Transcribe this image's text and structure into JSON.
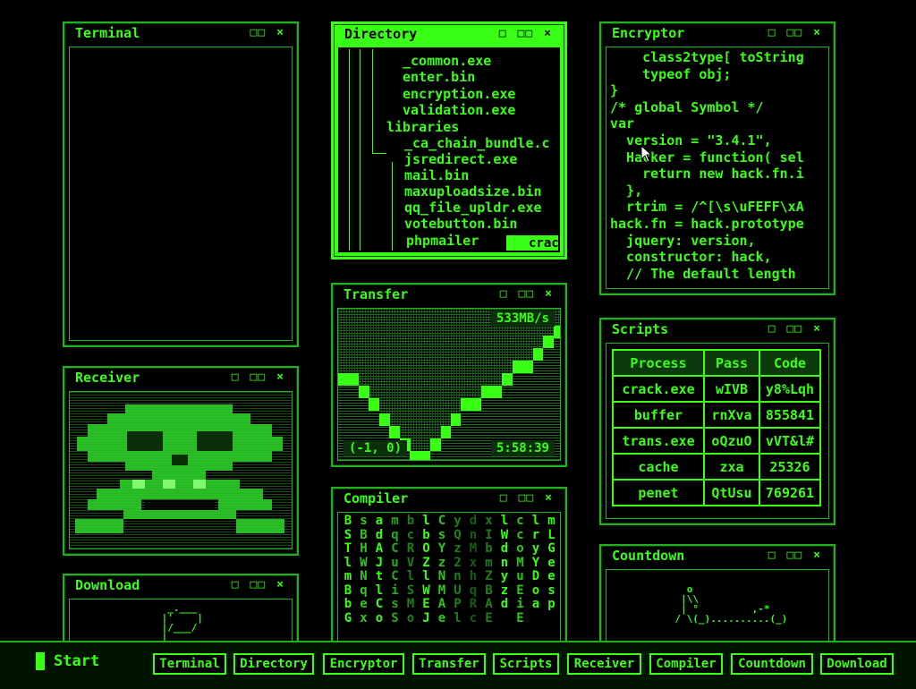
{
  "windows": {
    "terminal": {
      "title": "Terminal",
      "ctrl_max": "□□",
      "ctrl_close": "×"
    },
    "directory": {
      "title": "Directory",
      "ctrl_min": "□",
      "ctrl_max": "□□",
      "ctrl_close": "×",
      "entries": [
        "_common.exe",
        "enter.bin",
        "encryption.exe",
        "validation.exe",
        "libraries",
        "_ca_chain_bundle.c",
        "jsredirect.exe",
        "mail.bin",
        "maxuploadsize.bin",
        "qq_file_upldr.exe",
        "votebutton.bin",
        "phpmailer"
      ],
      "button": "crack"
    },
    "encryptor": {
      "title": "Encryptor",
      "ctrl_min": "□",
      "ctrl_max": "□□",
      "ctrl_close": "×",
      "lines": [
        "    class2type[ toString",
        "    typeof obj;",
        "}",
        "/* global Symbol */",
        "var",
        "  version = \"3.4.1\",",
        "  Hacker = function( sel",
        "    return new hack.fn.i",
        "  },",
        "  rtrim = /^[\\s\\uFEFF\\xA",
        "hack.fn = hack.prototype",
        "  jquery: version,",
        "  constructor: hack,",
        "  // The default length"
      ]
    },
    "transfer": {
      "title": "Transfer",
      "ctrl_min": "□",
      "ctrl_max": "□□",
      "ctrl_close": "×",
      "rate": "533MB/s",
      "coords": "(-1, 0)",
      "time": "5:58:39",
      "graph_levels": [
        0.62,
        0.62,
        0.52,
        0.42,
        0.3,
        0.2,
        0.1,
        0.0,
        0.0,
        0.1,
        0.2,
        0.3,
        0.42,
        0.42,
        0.52,
        0.52,
        0.62,
        0.72,
        0.72,
        0.82,
        0.92,
        1.0
      ]
    },
    "scripts": {
      "title": "Scripts",
      "ctrl_min": "□",
      "ctrl_max": "□□",
      "ctrl_close": "×",
      "headers": [
        "Process",
        "Pass",
        "Code"
      ],
      "rows": [
        [
          "crack.exe",
          "wIVB",
          "y8%Lqh"
        ],
        [
          "buffer",
          "rnXva",
          "855841"
        ],
        [
          "trans.exe",
          "oQzuO",
          "vVT&l#"
        ],
        [
          "cache",
          "zxa",
          "25326"
        ],
        [
          "penet",
          "QtUsu",
          "769261"
        ]
      ]
    },
    "receiver": {
      "title": "Receiver",
      "ctrl_min": "□",
      "ctrl_max": "□□",
      "ctrl_close": "×"
    },
    "compiler": {
      "title": "Compiler",
      "ctrl_min": "□",
      "ctrl_max": "□□",
      "ctrl_close": "×",
      "columns": [
        "BSTlmBbG",
        "sBHWNqex",
        "adAJtlCo",
        "mqCuCisS",
        "bcRVlSMo",
        "lbOZlWEJ",
        "CsYzNMAe",
        "yQz2nUPl",
        "dnMxhqRc",
        "xIbmZBAE",
        "lWdnyzd",
        "ccoMuEiE",
        "lryYDoa",
        "mLGeesp"
      ]
    },
    "countdown": {
      "title": "Countdown",
      "ctrl_min": "□",
      "ctrl_max": "□□",
      "ctrl_close": "×",
      "art": "      o\n     |\\\\\n     | °         ,-*\n    / \\(_)..........(_)"
    },
    "download": {
      "title": "Download",
      "ctrl_min": "□",
      "ctrl_max": "□□",
      "ctrl_close": "×",
      "art": "  _.___\n |'    |\n |/___/\n |"
    }
  },
  "taskbar": {
    "start": "Start",
    "buttons": [
      "Terminal",
      "Directory",
      "Encryptor",
      "Transfer",
      "Scripts",
      "Receiver",
      "Compiler",
      "Countdown",
      "Download"
    ]
  }
}
